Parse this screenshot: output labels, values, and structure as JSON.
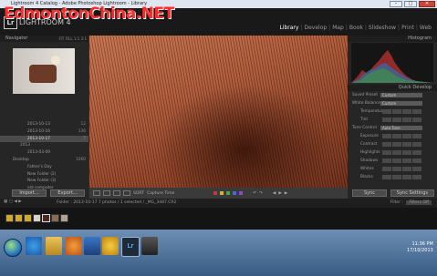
{
  "window": {
    "title": "Lightroom 4 Catalog - Adobe Photoshop Lightroom - Library",
    "controls": [
      "minimize",
      "maximize",
      "close"
    ]
  },
  "watermark": "EdmontonChina.NET",
  "app": {
    "logo": "Lr",
    "name": "LIGHTROOM 4"
  },
  "modules": [
    "Library",
    "Develop",
    "Map",
    "Book",
    "Slideshow",
    "Print",
    "Web"
  ],
  "active_module": "Library",
  "navigator": {
    "title": "Navigator",
    "zoom_options": "FIT  FILL  1:1  3:1"
  },
  "folders": [
    {
      "label": "2013-10-13",
      "count": "12",
      "selected": false,
      "level": 2
    },
    {
      "label": "2013-10-16",
      "count": "136",
      "selected": false,
      "level": 2
    },
    {
      "label": "2013-10-17",
      "count": "7",
      "selected": true,
      "level": 2
    },
    {
      "label": "2013",
      "count": "",
      "selected": false,
      "level": 1
    },
    {
      "label": "2013-03-09",
      "count": "",
      "selected": false,
      "level": 2
    },
    {
      "label": "Desktop",
      "count": "1060",
      "selected": false,
      "level": 0
    },
    {
      "label": "Father's Day",
      "count": "",
      "selected": false,
      "level": 2
    },
    {
      "label": "New Folder (2)",
      "count": "",
      "selected": false,
      "level": 2
    },
    {
      "label": "New Folder (3)",
      "count": "",
      "selected": false,
      "level": 2
    },
    {
      "label": "old computer",
      "count": "",
      "selected": false,
      "level": 2
    }
  ],
  "left_buttons": {
    "import": "Import...",
    "export": "Export..."
  },
  "toolbar": {
    "sort_label": "SORT",
    "sort_value": "Capture Time",
    "flag_colors": [
      "#c23b3b",
      "#d6b12c",
      "#4ba34b",
      "#3f6fc7",
      "#8a4ec0"
    ]
  },
  "right_panel": {
    "histogram_title": "Histogram",
    "quick_develop_title": "Quick Develop",
    "saved_preset": {
      "label": "Saved Preset",
      "value": "Custom"
    },
    "white_balance": {
      "label": "White Balance",
      "value": "Custom"
    },
    "temperature": "Temperature",
    "tint": "Tint",
    "tone_control": {
      "label": "Tone Control",
      "value": "Auto Tone"
    },
    "tone_rows": [
      "Exposure",
      "Contrast",
      "Highlights",
      "Shadows",
      "Whites",
      "Blacks"
    ]
  },
  "right_buttons": {
    "sync": "Sync",
    "reset": "Sync Settings"
  },
  "filmstrip": {
    "info": "Folder : 2013-10-17     7 photos / 1 selected / _MG_3487.CR2",
    "filter_label": "Filter :",
    "filter_value": "Filters Off"
  },
  "taskbar": {
    "time": "11:36 PM",
    "date": "17/10/2013"
  }
}
